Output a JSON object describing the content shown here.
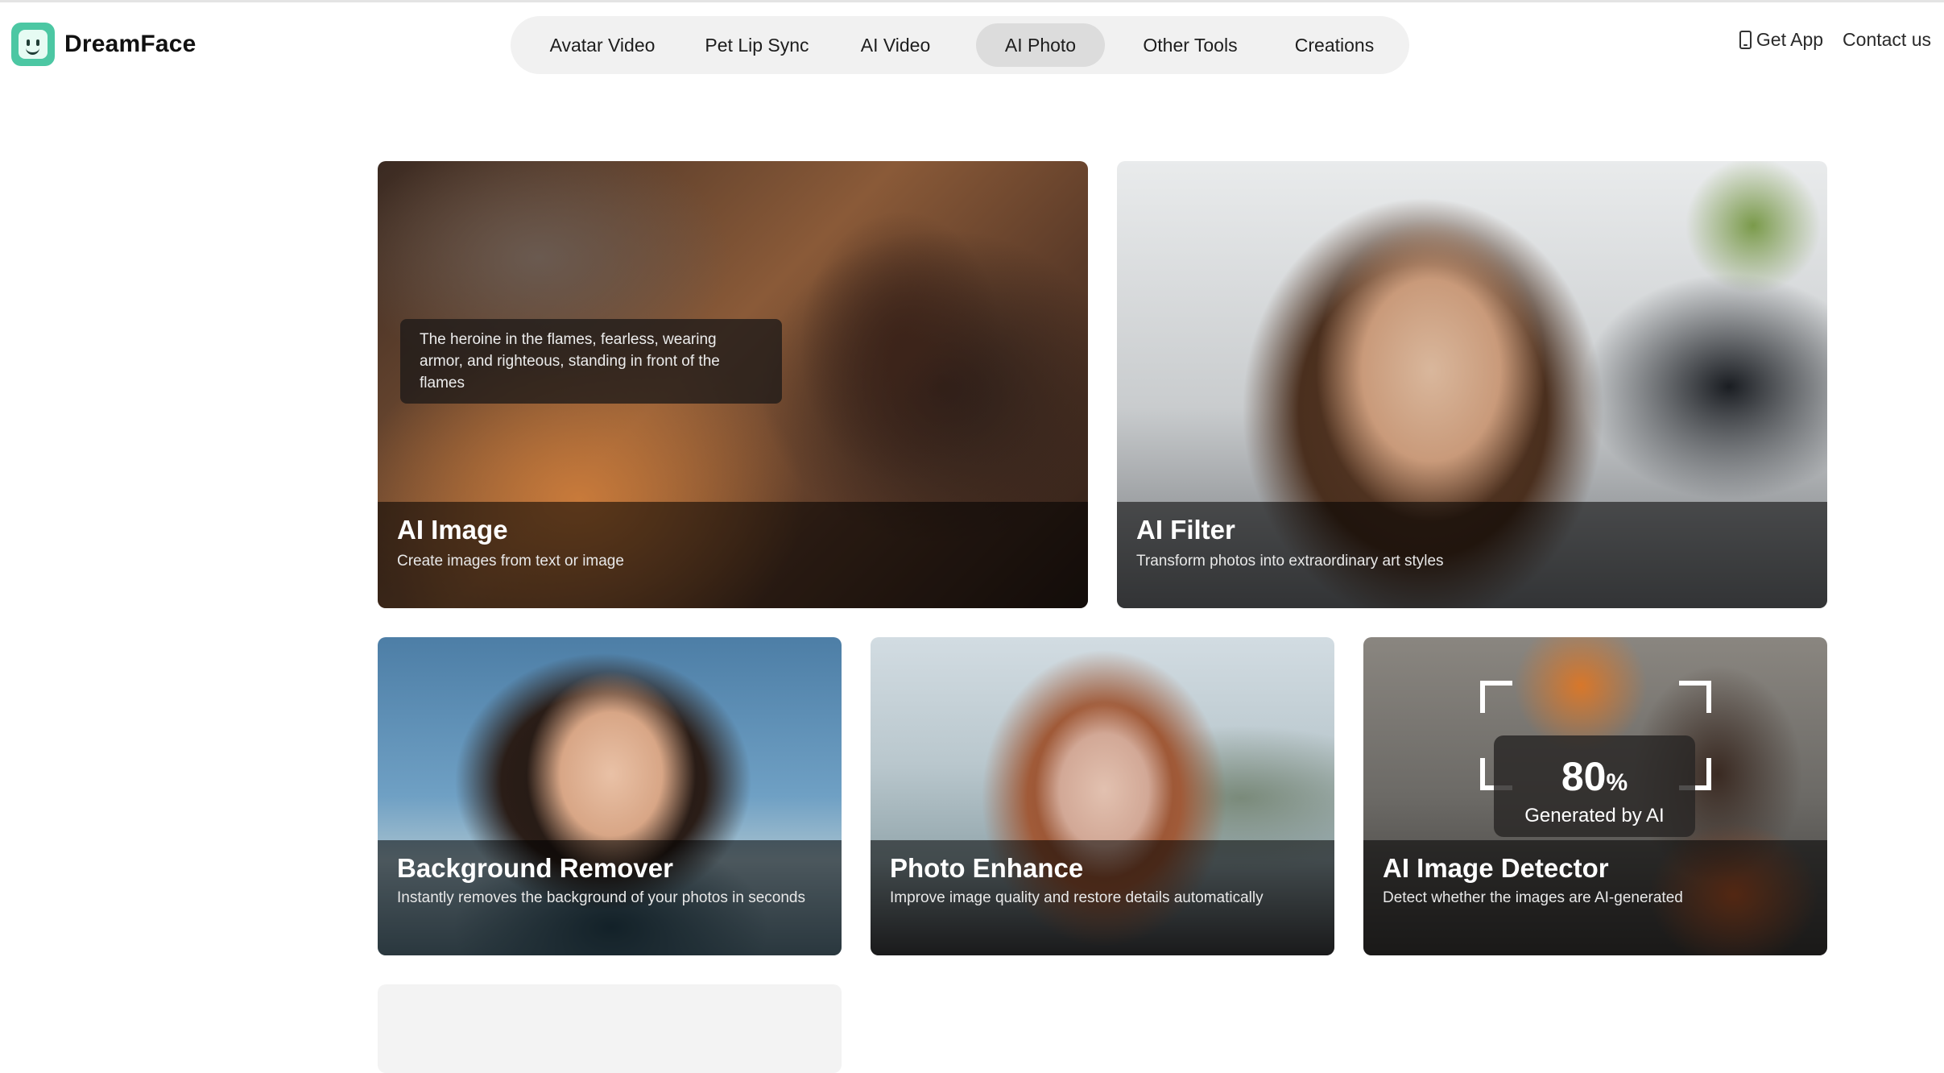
{
  "app": {
    "name": "DreamFace",
    "logo_icon": "smiley-face-icon",
    "brand_color": "#4cc7a3"
  },
  "nav": {
    "items": [
      {
        "label": "Avatar Video",
        "active": false
      },
      {
        "label": "Pet Lip Sync",
        "active": false
      },
      {
        "label": "AI Video",
        "active": false
      },
      {
        "label": "AI Photo",
        "active": true
      },
      {
        "label": "Other Tools",
        "active": false
      },
      {
        "label": "Creations",
        "active": false
      }
    ]
  },
  "header_right": {
    "get_app": "Get App",
    "get_app_icon": "phone-icon",
    "contact": "Contact us"
  },
  "cards": [
    {
      "title": "AI Image",
      "description": "Create images from text or image",
      "prompt": "The heroine in the flames, fearless, wearing armor, and righteous, standing in front of the flames"
    },
    {
      "title": "AI Filter",
      "description": "Transform photos into extraordinary art styles"
    },
    {
      "title": "Background Remover",
      "description": "Instantly removes the background of your photos in seconds"
    },
    {
      "title": "Photo Enhance",
      "description": "Improve image quality and restore details automatically"
    },
    {
      "title": "AI Image Detector",
      "description": "Detect whether the images are AI-generated",
      "badge": {
        "value": "80",
        "unit": "%",
        "label": "Generated by AI"
      }
    }
  ]
}
